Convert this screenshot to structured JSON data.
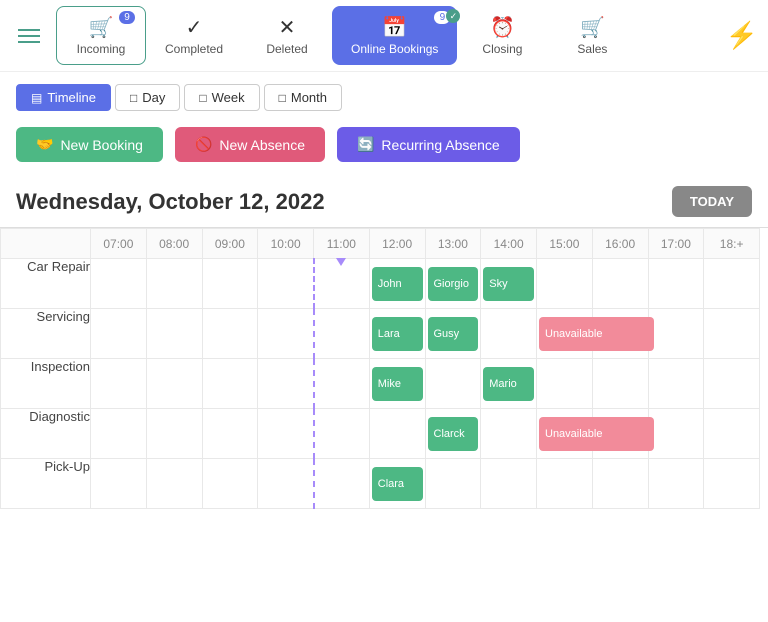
{
  "nav": {
    "tabs": [
      {
        "id": "incoming",
        "label": "Incoming",
        "icon": "🛒",
        "badge": "9",
        "badge_type": "blue",
        "active": false
      },
      {
        "id": "completed",
        "label": "Completed",
        "icon": "✓",
        "badge": null,
        "active": false
      },
      {
        "id": "deleted",
        "label": "Deleted",
        "icon": "✕",
        "badge": null,
        "active": false
      },
      {
        "id": "online-bookings",
        "label": "Online Bookings",
        "icon": "📅",
        "badge": "9",
        "badge_type": "blue",
        "active": true
      },
      {
        "id": "closing",
        "label": "Closing",
        "icon": "⏰",
        "badge": null,
        "active": false
      },
      {
        "id": "sales",
        "label": "Sales",
        "icon": "🛒",
        "badge": null,
        "active": false
      }
    ]
  },
  "view_controls": {
    "buttons": [
      {
        "id": "timeline",
        "label": "Timeline",
        "icon": "▤",
        "active": true
      },
      {
        "id": "day",
        "label": "Day",
        "icon": "□",
        "active": false
      },
      {
        "id": "week",
        "label": "Week",
        "icon": "□",
        "active": false
      },
      {
        "id": "month",
        "label": "Month",
        "icon": "□",
        "active": false
      }
    ]
  },
  "action_buttons": {
    "new_booking": "New Booking",
    "new_absence": "New Absence",
    "recurring_absence": "Recurring Absence"
  },
  "date_header": {
    "weekday": "Wednesday,",
    "date": "October 12, 2022",
    "today_label": "TODAY"
  },
  "calendar": {
    "time_slots": [
      "07:00",
      "08:00",
      "09:00",
      "10:00",
      "11:00",
      "12:00",
      "13:00",
      "14:00",
      "15:00",
      "16:00",
      "17:00",
      "18:+"
    ],
    "rows": [
      {
        "label": "Car Repair",
        "events": [
          {
            "col": 5,
            "label": "John",
            "type": "green",
            "span": 1
          },
          {
            "col": 6,
            "label": "Giorgio",
            "type": "green",
            "span": 1
          },
          {
            "col": 7,
            "label": "Sky",
            "type": "green",
            "span": 1
          }
        ]
      },
      {
        "label": "Servicing",
        "events": [
          {
            "col": 5,
            "label": "Lara",
            "type": "green",
            "span": 1
          },
          {
            "col": 6,
            "label": "Gusy",
            "type": "green",
            "span": 1
          },
          {
            "col": 8,
            "label": "Unavailable",
            "type": "unavail",
            "span": 2
          }
        ]
      },
      {
        "label": "Inspection",
        "events": [
          {
            "col": 5,
            "label": "Mike",
            "type": "green",
            "span": 1
          },
          {
            "col": 7,
            "label": "Mario",
            "type": "green",
            "span": 1
          }
        ]
      },
      {
        "label": "Diagnostic",
        "events": [
          {
            "col": 6,
            "label": "Clarck",
            "type": "green",
            "span": 1
          },
          {
            "col": 8,
            "label": "Unavailable",
            "type": "unavail",
            "span": 2
          }
        ]
      },
      {
        "label": "Pick-Up",
        "events": [
          {
            "col": 5,
            "label": "Clara",
            "type": "green",
            "span": 1
          }
        ]
      }
    ]
  }
}
